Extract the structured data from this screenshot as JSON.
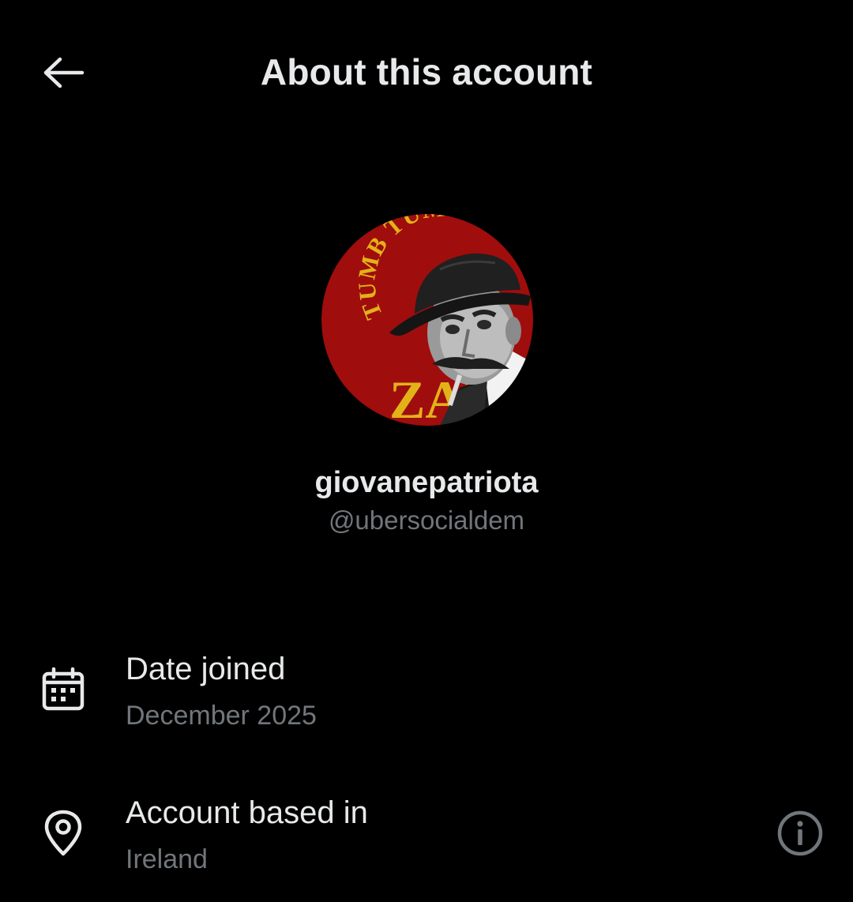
{
  "header": {
    "title": "About this account",
    "back_icon": "arrow-left-icon"
  },
  "profile": {
    "avatar_icon": "avatar-image",
    "avatar_text_top": "TUMB TUMB",
    "avatar_text_bottom": "ZANG",
    "avatar_bg_color": "#a00d0d",
    "avatar_text_color": "#e2b219",
    "display_name": "giovanepatriota",
    "handle": "@ubersocialdem"
  },
  "details": [
    {
      "icon": "calendar-icon",
      "label": "Date joined",
      "value": "December 2025"
    },
    {
      "icon": "location-pin-icon",
      "label": "Account based in",
      "value": "Ireland",
      "info_icon": "info-icon"
    }
  ],
  "colors": {
    "background": "#000000",
    "primary_text": "#e7e9ea",
    "secondary_text": "#71767b"
  }
}
